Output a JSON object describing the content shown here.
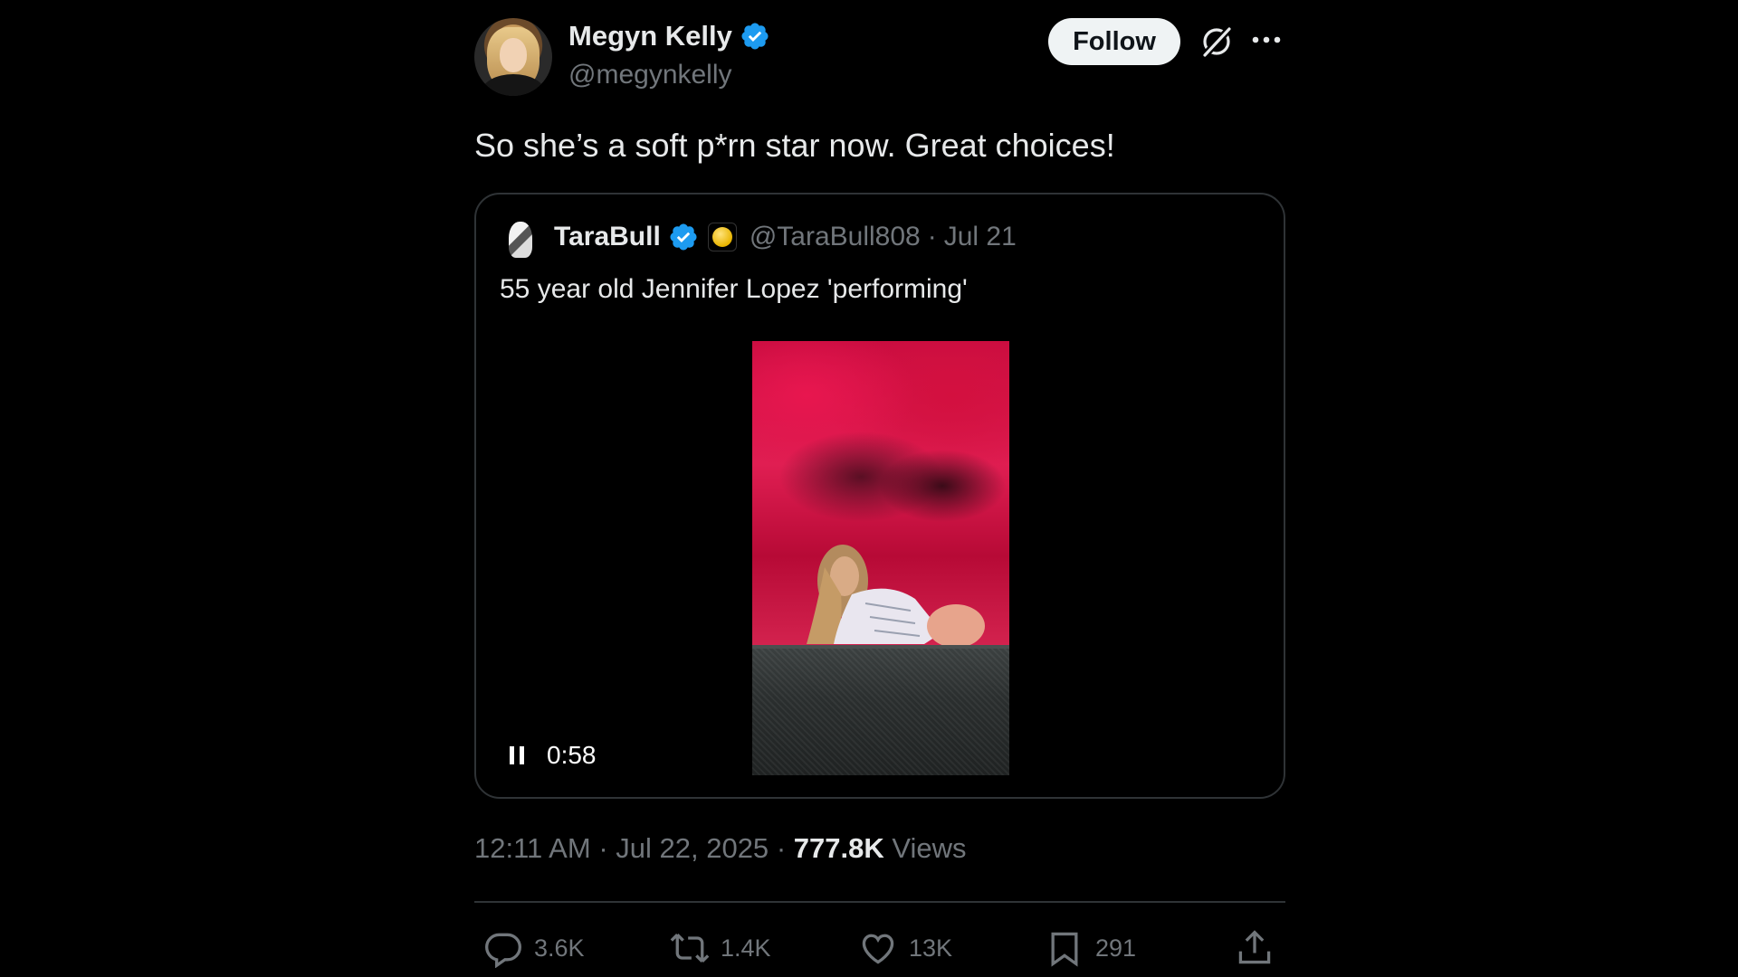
{
  "author": {
    "name": "Megyn Kelly",
    "handle": "@megynkelly",
    "verified": true
  },
  "header": {
    "follow_label": "Follow",
    "grok_icon": "grok-icon",
    "more_icon": "more-icon"
  },
  "tweet": {
    "text": "So she’s a soft p*rn star now. Great choices!"
  },
  "quote": {
    "name": "TaraBull",
    "handle": "@TaraBull808",
    "separator": "·",
    "date": "Jul 21",
    "text": "55 year old Jennifer Lopez 'performing'",
    "video": {
      "time": "0:58",
      "state_icon": "pause-icon"
    }
  },
  "meta": {
    "time": "12:11 AM",
    "sep1": "·",
    "date": "Jul 22, 2025",
    "sep2": "·",
    "views_count": "777.8K",
    "views_label": "Views"
  },
  "actions": {
    "replies": "3.6K",
    "reposts": "1.4K",
    "likes": "13K",
    "bookmarks": "291"
  },
  "colors": {
    "background": "#000000",
    "text": "#e7e9ea",
    "muted": "#71767b",
    "verified": "#1d9bf0",
    "border": "#2f3336",
    "follow_bg": "#eff3f4"
  }
}
